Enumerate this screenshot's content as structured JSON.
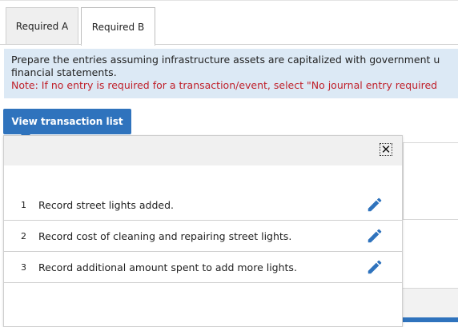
{
  "tabs": [
    {
      "label": "Required A",
      "active": false
    },
    {
      "label": "Required B",
      "active": true
    }
  ],
  "instructions": {
    "line1": "Prepare the entries assuming infrastructure assets are capitalized with government u",
    "line2": "financial statements.",
    "note": "Note: If no entry is required for a transaction/event, select \"No journal entry required"
  },
  "view_button": {
    "label": "View transaction list"
  },
  "popover": {
    "close_icon": "close-x-icon",
    "transactions": [
      {
        "num": "1",
        "text": "Record street lights added.",
        "icon": "pencil-edit-icon"
      },
      {
        "num": "2",
        "text": "Record cost of cleaning and repairing street lights.",
        "icon": "pencil-edit-icon"
      },
      {
        "num": "3",
        "text": "Record additional amount spent to add more lights.",
        "icon": "pencil-edit-icon"
      }
    ]
  },
  "colors": {
    "accent": "#2f73bd",
    "instruction_bg": "#dce9f5",
    "note_red": "#c0202a"
  }
}
